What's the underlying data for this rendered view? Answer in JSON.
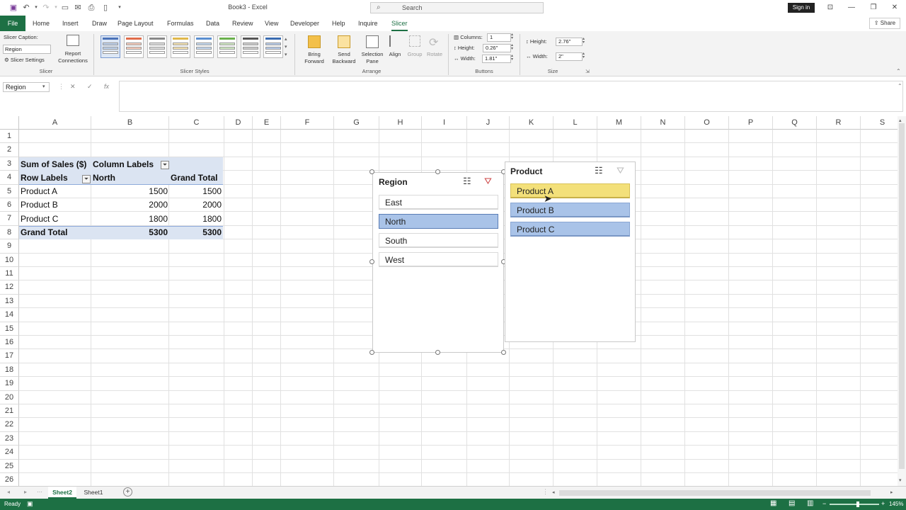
{
  "app": {
    "title": "Book3 - Excel",
    "search_placeholder": "Search",
    "sign_in": "Sign in",
    "share": "Share"
  },
  "tabs": [
    "File",
    "Home",
    "Insert",
    "Draw",
    "Page Layout",
    "Formulas",
    "Data",
    "Review",
    "View",
    "Developer",
    "Help",
    "Inquire",
    "Slicer"
  ],
  "active_tab": "Slicer",
  "ribbon": {
    "slicer_group": {
      "caption_label": "Slicer Caption:",
      "caption_value": "Region",
      "settings_label": "Slicer Settings",
      "report_connections_1": "Report",
      "report_connections_2": "Connections",
      "group_label": "Slicer"
    },
    "styles_group_label": "Slicer Styles",
    "arrange": {
      "bring_forward_1": "Bring",
      "bring_forward_2": "Forward",
      "send_backward_1": "Send",
      "send_backward_2": "Backward",
      "selection_pane_1": "Selection",
      "selection_pane_2": "Pane",
      "align": "Align",
      "group": "Group",
      "rotate": "Rotate",
      "group_label": "Arrange"
    },
    "buttons": {
      "columns_label": "Columns:",
      "columns_value": "1",
      "height_label": "Height:",
      "height_value": "0.26\"",
      "width_label": "Width:",
      "width_value": "1.81\"",
      "group_label": "Buttons"
    },
    "size": {
      "height_label": "Height:",
      "height_value": "2.76\"",
      "width_label": "Width:",
      "width_value": "2\"",
      "group_label": "Size"
    }
  },
  "formula_bar": {
    "name_box": "Region",
    "cancel_icon": "✕",
    "enter_icon": "✓",
    "fx": "fx",
    "content": ""
  },
  "columns": [
    "A",
    "B",
    "C",
    "D",
    "E",
    "F",
    "G",
    "H",
    "I",
    "J",
    "K",
    "L",
    "M",
    "N",
    "O",
    "P",
    "Q",
    "R",
    "S"
  ],
  "rows": [
    "1",
    "2",
    "3",
    "4",
    "5",
    "6",
    "7",
    "8",
    "9",
    "10",
    "11",
    "12",
    "13",
    "14",
    "15",
    "16",
    "17",
    "18",
    "19",
    "20",
    "21",
    "22",
    "23",
    "24",
    "25",
    "26"
  ],
  "pivot": {
    "sum_label": "Sum of Sales ($)",
    "column_labels": "Column Labels",
    "row_labels": "Row Labels",
    "north": "North",
    "grand_total_col": "Grand Total",
    "rows": [
      {
        "label": "Product A",
        "north": "1500",
        "total": "1500"
      },
      {
        "label": "Product B",
        "north": "2000",
        "total": "2000"
      },
      {
        "label": "Product C",
        "north": "1800",
        "total": "1800"
      }
    ],
    "grand_total": {
      "label": "Grand Total",
      "north": "5300",
      "total": "5300"
    }
  },
  "region_slicer": {
    "title": "Region",
    "items": [
      "East",
      "North",
      "South",
      "West"
    ],
    "selected": "North"
  },
  "product_slicer": {
    "title": "Product",
    "items": [
      "Product A",
      "Product B",
      "Product C"
    ],
    "hovered": "Product A"
  },
  "sheets": [
    "Sheet2",
    "Sheet1"
  ],
  "active_sheet": "Sheet2",
  "status": {
    "ready": "Ready",
    "zoom": "145%"
  },
  "colors": {
    "excel_green": "#1d7044",
    "pivot_band": "#dbe4f2",
    "slicer_selected": "#a9c3e8",
    "slicer_hover": "#f3e07a"
  }
}
